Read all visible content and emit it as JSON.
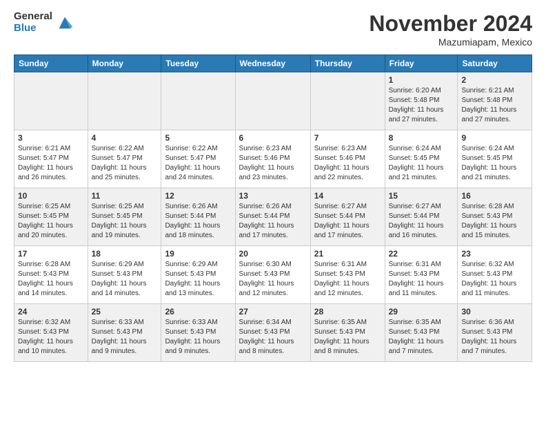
{
  "header": {
    "logo_general": "General",
    "logo_blue": "Blue",
    "month": "November 2024",
    "location": "Mazumiapam, Mexico"
  },
  "weekdays": [
    "Sunday",
    "Monday",
    "Tuesday",
    "Wednesday",
    "Thursday",
    "Friday",
    "Saturday"
  ],
  "weeks": [
    [
      {
        "day": "",
        "info": ""
      },
      {
        "day": "",
        "info": ""
      },
      {
        "day": "",
        "info": ""
      },
      {
        "day": "",
        "info": ""
      },
      {
        "day": "",
        "info": ""
      },
      {
        "day": "1",
        "info": "Sunrise: 6:20 AM\nSunset: 5:48 PM\nDaylight: 11 hours\nand 27 minutes."
      },
      {
        "day": "2",
        "info": "Sunrise: 6:21 AM\nSunset: 5:48 PM\nDaylight: 11 hours\nand 27 minutes."
      }
    ],
    [
      {
        "day": "3",
        "info": "Sunrise: 6:21 AM\nSunset: 5:47 PM\nDaylight: 11 hours\nand 26 minutes."
      },
      {
        "day": "4",
        "info": "Sunrise: 6:22 AM\nSunset: 5:47 PM\nDaylight: 11 hours\nand 25 minutes."
      },
      {
        "day": "5",
        "info": "Sunrise: 6:22 AM\nSunset: 5:47 PM\nDaylight: 11 hours\nand 24 minutes."
      },
      {
        "day": "6",
        "info": "Sunrise: 6:23 AM\nSunset: 5:46 PM\nDaylight: 11 hours\nand 23 minutes."
      },
      {
        "day": "7",
        "info": "Sunrise: 6:23 AM\nSunset: 5:46 PM\nDaylight: 11 hours\nand 22 minutes."
      },
      {
        "day": "8",
        "info": "Sunrise: 6:24 AM\nSunset: 5:45 PM\nDaylight: 11 hours\nand 21 minutes."
      },
      {
        "day": "9",
        "info": "Sunrise: 6:24 AM\nSunset: 5:45 PM\nDaylight: 11 hours\nand 21 minutes."
      }
    ],
    [
      {
        "day": "10",
        "info": "Sunrise: 6:25 AM\nSunset: 5:45 PM\nDaylight: 11 hours\nand 20 minutes."
      },
      {
        "day": "11",
        "info": "Sunrise: 6:25 AM\nSunset: 5:45 PM\nDaylight: 11 hours\nand 19 minutes."
      },
      {
        "day": "12",
        "info": "Sunrise: 6:26 AM\nSunset: 5:44 PM\nDaylight: 11 hours\nand 18 minutes."
      },
      {
        "day": "13",
        "info": "Sunrise: 6:26 AM\nSunset: 5:44 PM\nDaylight: 11 hours\nand 17 minutes."
      },
      {
        "day": "14",
        "info": "Sunrise: 6:27 AM\nSunset: 5:44 PM\nDaylight: 11 hours\nand 17 minutes."
      },
      {
        "day": "15",
        "info": "Sunrise: 6:27 AM\nSunset: 5:44 PM\nDaylight: 11 hours\nand 16 minutes."
      },
      {
        "day": "16",
        "info": "Sunrise: 6:28 AM\nSunset: 5:43 PM\nDaylight: 11 hours\nand 15 minutes."
      }
    ],
    [
      {
        "day": "17",
        "info": "Sunrise: 6:28 AM\nSunset: 5:43 PM\nDaylight: 11 hours\nand 14 minutes."
      },
      {
        "day": "18",
        "info": "Sunrise: 6:29 AM\nSunset: 5:43 PM\nDaylight: 11 hours\nand 14 minutes."
      },
      {
        "day": "19",
        "info": "Sunrise: 6:29 AM\nSunset: 5:43 PM\nDaylight: 11 hours\nand 13 minutes."
      },
      {
        "day": "20",
        "info": "Sunrise: 6:30 AM\nSunset: 5:43 PM\nDaylight: 11 hours\nand 12 minutes."
      },
      {
        "day": "21",
        "info": "Sunrise: 6:31 AM\nSunset: 5:43 PM\nDaylight: 11 hours\nand 12 minutes."
      },
      {
        "day": "22",
        "info": "Sunrise: 6:31 AM\nSunset: 5:43 PM\nDaylight: 11 hours\nand 11 minutes."
      },
      {
        "day": "23",
        "info": "Sunrise: 6:32 AM\nSunset: 5:43 PM\nDaylight: 11 hours\nand 11 minutes."
      }
    ],
    [
      {
        "day": "24",
        "info": "Sunrise: 6:32 AM\nSunset: 5:43 PM\nDaylight: 11 hours\nand 10 minutes."
      },
      {
        "day": "25",
        "info": "Sunrise: 6:33 AM\nSunset: 5:43 PM\nDaylight: 11 hours\nand 9 minutes."
      },
      {
        "day": "26",
        "info": "Sunrise: 6:33 AM\nSunset: 5:43 PM\nDaylight: 11 hours\nand 9 minutes."
      },
      {
        "day": "27",
        "info": "Sunrise: 6:34 AM\nSunset: 5:43 PM\nDaylight: 11 hours\nand 8 minutes."
      },
      {
        "day": "28",
        "info": "Sunrise: 6:35 AM\nSunset: 5:43 PM\nDaylight: 11 hours\nand 8 minutes."
      },
      {
        "day": "29",
        "info": "Sunrise: 6:35 AM\nSunset: 5:43 PM\nDaylight: 11 hours\nand 7 minutes."
      },
      {
        "day": "30",
        "info": "Sunrise: 6:36 AM\nSunset: 5:43 PM\nDaylight: 11 hours\nand 7 minutes."
      }
    ]
  ]
}
